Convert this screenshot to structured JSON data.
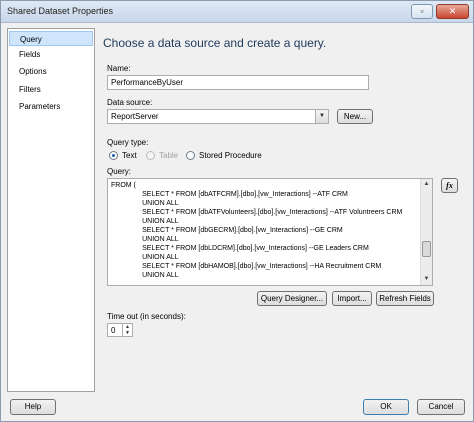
{
  "window": {
    "title": "Shared Dataset Properties"
  },
  "sidebar": {
    "items": [
      {
        "label": "Query"
      },
      {
        "label": "Fields"
      },
      {
        "label": "Options"
      },
      {
        "label": "Filters"
      },
      {
        "label": "Parameters"
      }
    ]
  },
  "main": {
    "heading": "Choose a data source and create a query.",
    "name_label": "Name:",
    "name_value": "PerformanceByUser",
    "data_source_label": "Data source:",
    "data_source_value": "ReportServer",
    "new_button": "New...",
    "query_type_label": "Query type:",
    "query_types": [
      {
        "label": "Text",
        "selected": true,
        "enabled": true
      },
      {
        "label": "Table",
        "selected": false,
        "enabled": false
      },
      {
        "label": "Stored Procedure",
        "selected": false,
        "enabled": true
      }
    ],
    "query_label": "Query:",
    "query_lines": [
      "FROM (",
      "                SELECT * FROM [dbATFCRM].[dbo].[vw_Interactions] --ATF CRM",
      "                UNION ALL",
      "                SELECT * FROM [dbATFVolunteers].[dbo].[vw_Interactions] --ATF Voluntreers CRM",
      "                UNION ALL",
      "                SELECT * FROM [dbGECRM].[dbo].[vw_Interactions] --GE CRM",
      "                UNION ALL",
      "                SELECT * FROM [dbLDCRM].[dbo].[vw_Interactions] --GE Leaders CRM",
      "                UNION ALL",
      "                SELECT * FROM [dbHAMOB].[dbo].[vw_Interactions] --HA Recruitment CRM",
      "                UNION ALL"
    ],
    "fx_label": "fx",
    "query_designer_button": "Query Designer...",
    "import_button": "Import...",
    "refresh_fields_button": "Refresh Fields",
    "timeout_label": "Time out (in seconds):",
    "timeout_value": "0"
  },
  "footer": {
    "help_button": "Help",
    "ok_button": "OK",
    "cancel_button": "Cancel"
  }
}
